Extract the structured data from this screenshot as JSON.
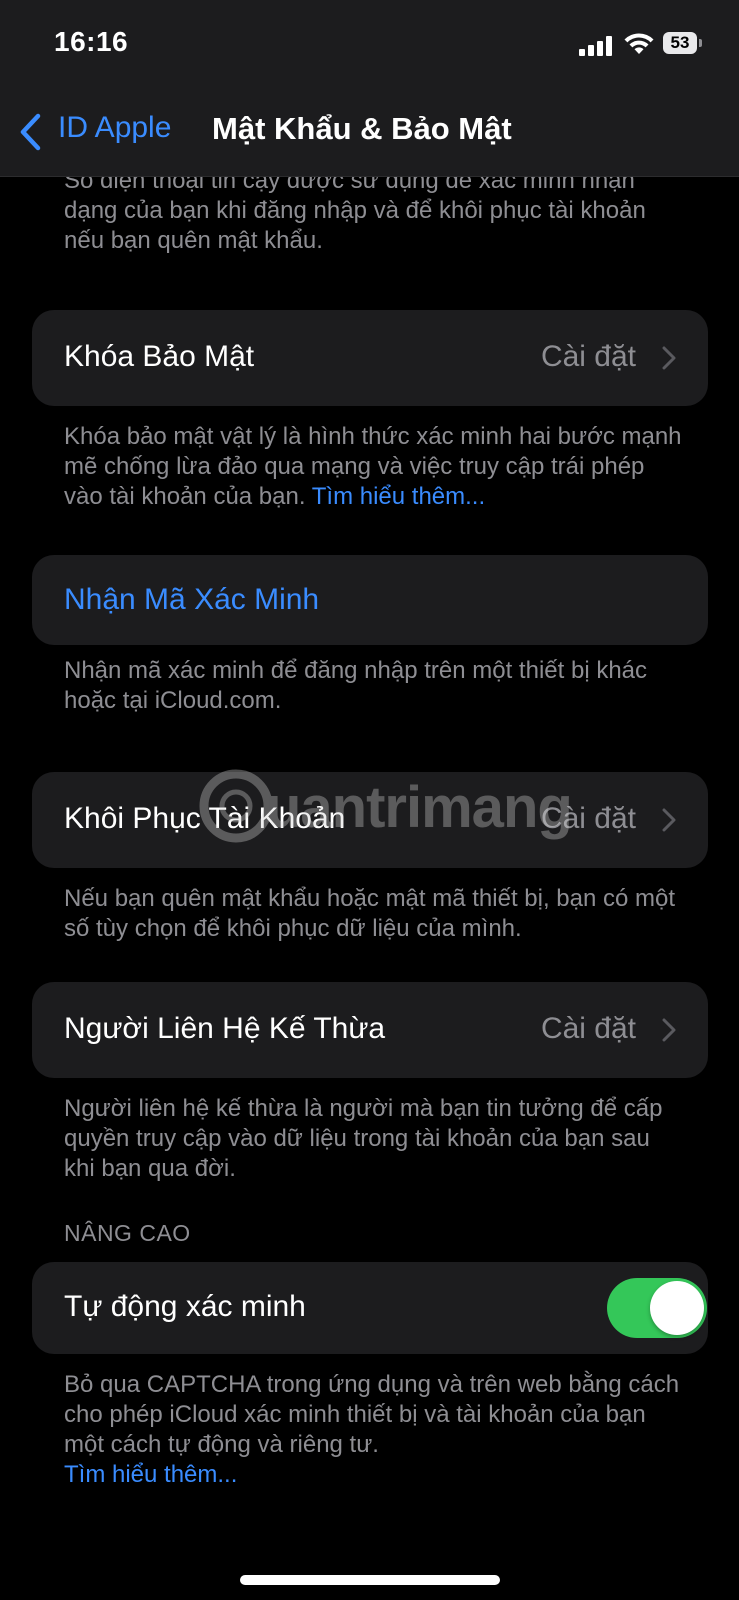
{
  "status_bar": {
    "time": "16:16",
    "battery": "53"
  },
  "nav": {
    "back_label": "ID Apple",
    "title": "Mật Khẩu & Bảo Mật"
  },
  "top_note": "Số điện thoại tin cậy được sử dụng để xác minh nhận dạng của bạn khi đăng nhập và để khôi phục tài khoản nếu bạn quên mật khẩu.",
  "security_key": {
    "label": "Khóa Bảo Mật",
    "value": "Cài đặt",
    "note": "Khóa bảo mật vật lý là hình thức xác minh hai bước mạnh mẽ chống lừa đảo qua mạng và việc truy cập trái phép vào tài khoản của bạn.",
    "note_link": "Tìm hiểu thêm..."
  },
  "get_code": {
    "label": "Nhận Mã Xác Minh",
    "note": "Nhận mã xác minh để đăng nhập trên một thiết bị khác hoặc tại iCloud.com."
  },
  "account_recovery": {
    "label": "Khôi Phục Tài Khoản",
    "value": "Cài đặt",
    "note": "Nếu bạn quên mật khẩu hoặc mật mã thiết bị, bạn có một số tùy chọn để khôi phục dữ liệu của mình."
  },
  "legacy_contact": {
    "label": "Người Liên Hệ Kế Thừa",
    "value": "Cài đặt",
    "note": "Người liên hệ kế thừa là người mà bạn tin tưởng để cấp quyền truy cập vào dữ liệu trong tài khoản của bạn sau khi bạn qua đời."
  },
  "advanced": {
    "header": "NÂNG CAO",
    "auto_verify_label": "Tự động xác minh",
    "auto_verify_on": true,
    "note": "Bỏ qua CAPTCHA trong ứng dụng và trên web bằng cách cho phép iCloud xác minh thiết bị và tài khoản của bạn một cách tự động và riêng tư.",
    "note_link": "Tìm hiểu thêm..."
  },
  "watermark": "uantrimang",
  "colors": {
    "accent": "#3a8cff",
    "toggle_on": "#34c759",
    "cell_bg": "#1c1c1e"
  }
}
